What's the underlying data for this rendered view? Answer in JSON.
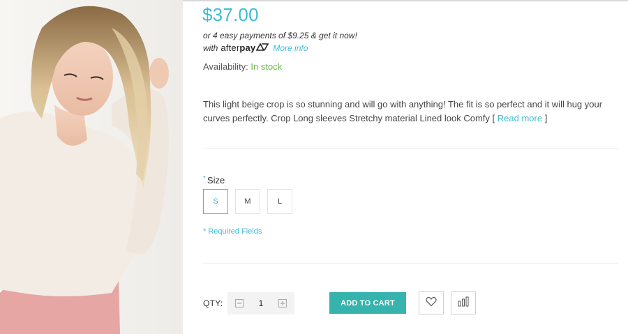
{
  "product": {
    "price": "$37.00",
    "afterpay": {
      "installments_text": "or 4 easy payments of $9.25 & get it now!",
      "with_text": "with",
      "logo_text_light": "after",
      "logo_text_bold": "pay",
      "more_info_label": "More info"
    },
    "availability": {
      "label": "Availability:",
      "status": "In stock",
      "status_color": "#6cbd45"
    },
    "description": {
      "text": "This light beige crop is so stunning and will go with anything! The fit is so perfect and it will hug your curves perfectly.  Crop Long sleeves Stretchy material Lined look Comfy",
      "open_bracket": "[",
      "read_more_label": "Read more",
      "close_bracket": "]"
    }
  },
  "options": {
    "size": {
      "required_marker": "*",
      "label": "Size",
      "choices": [
        "S",
        "M",
        "L"
      ],
      "selected": "S"
    },
    "required_fields_note": "* Required Fields"
  },
  "purchase": {
    "qty_label": "QTY:",
    "qty_value": "1",
    "decrease_icon": "minus-box-icon",
    "increase_icon": "plus-box-icon",
    "add_to_cart_label": "ADD TO CART",
    "wishlist_icon": "heart-icon",
    "compare_icon": "bar-chart-icon"
  },
  "colors": {
    "accent": "#3dbcd3",
    "cart_button": "#36b3ad",
    "in_stock": "#6cbd45"
  }
}
